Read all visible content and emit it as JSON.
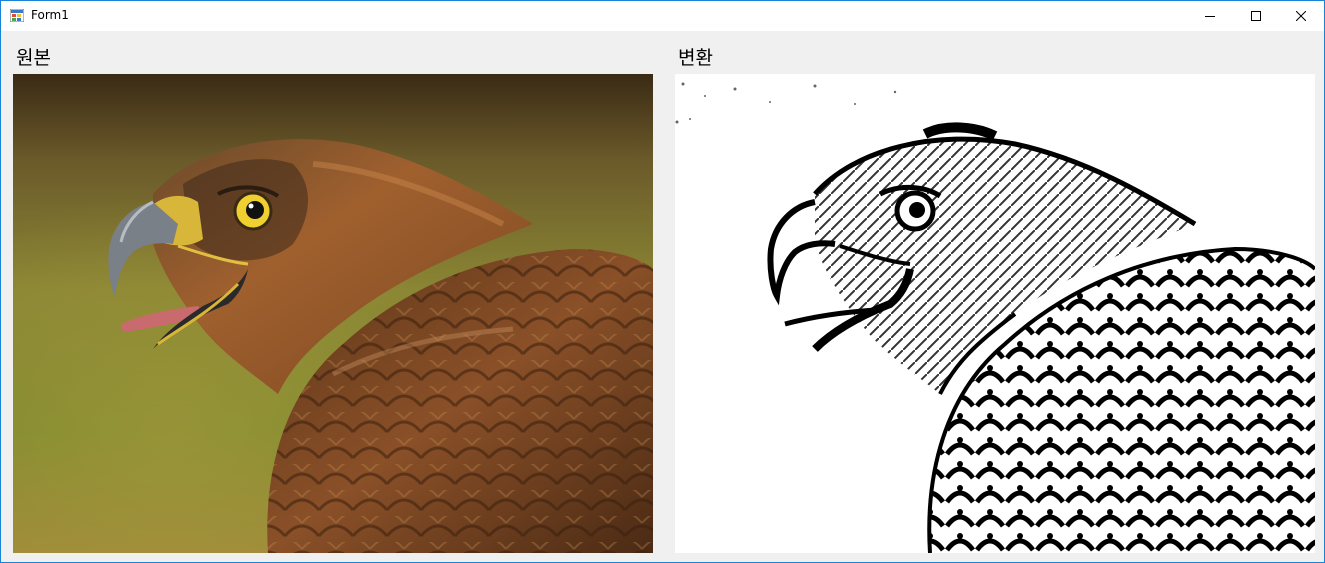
{
  "window": {
    "title": "Form1",
    "icons": {
      "app": "winforms-app-icon",
      "minimize": "minimize-icon",
      "maximize": "maximize-icon",
      "close": "close-icon"
    }
  },
  "labels": {
    "original": "원본",
    "converted": "변환"
  },
  "colors": {
    "window_border": "#1883d7",
    "client_bg": "#f0f0f0",
    "titlebar_bg": "#ffffff"
  }
}
